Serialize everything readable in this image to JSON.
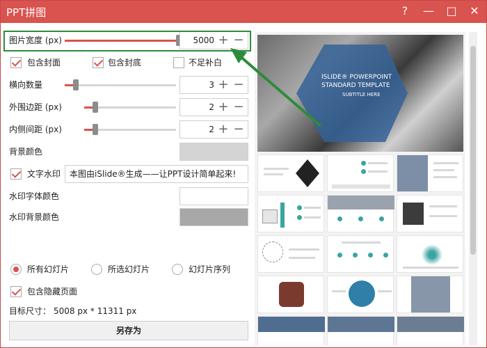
{
  "window": {
    "title": "PPT拼图"
  },
  "titlebar": {
    "help": "?",
    "minimize": "—",
    "maximize": "□",
    "close": "✕"
  },
  "controls": {
    "width": {
      "label": "图片宽度 (px)",
      "value": "5000",
      "fraction": 1.0
    },
    "include_cover": {
      "label": "包含封面",
      "checked": true
    },
    "include_back": {
      "label": "包含封底",
      "checked": true
    },
    "fill_blank": {
      "label": "不足补白",
      "checked": false
    },
    "columns": {
      "label": "横向数量",
      "value": "3",
      "fraction": 0.1
    },
    "outer_margin": {
      "label": "外围边距 (px)",
      "value": "2",
      "fraction": 0.12
    },
    "inner_spacing": {
      "label": "内侧间距 (px)",
      "value": "2",
      "fraction": 0.12
    },
    "bg_color": {
      "label": "背景颜色",
      "color": "#d4d4d4"
    },
    "watermark": {
      "label": "文字水印",
      "checked": true,
      "text": "本图由iSlide®生成——让PPT设计简单起来!"
    },
    "wm_font_color": {
      "label": "水印字体颜色",
      "color": "#ffffff"
    },
    "wm_bg_color": {
      "label": "水印背景颜色",
      "color": "#a8a8a8"
    }
  },
  "scope": {
    "all": {
      "label": "所有幻灯片",
      "selected": true
    },
    "selected": {
      "label": "所选幻灯片",
      "selected": false
    },
    "sequence": {
      "label": "幻灯片序列",
      "selected": false
    }
  },
  "include_hidden": {
    "label": "包含隐藏页面",
    "checked": true
  },
  "target_size": {
    "label": "目标尺寸：",
    "value": "5008 px * 11311 px"
  },
  "save_button": {
    "label": "另存为"
  },
  "preview": {
    "cover_title1": "ISLIDE® POWERPOINT",
    "cover_title2": "STANDARD TEMPLATE",
    "cover_subtitle": "SUBTITLE HERE"
  },
  "colors": {
    "accent": "#d9534f",
    "highlight": "#2e8b3a",
    "cover_blue": "#356198"
  }
}
